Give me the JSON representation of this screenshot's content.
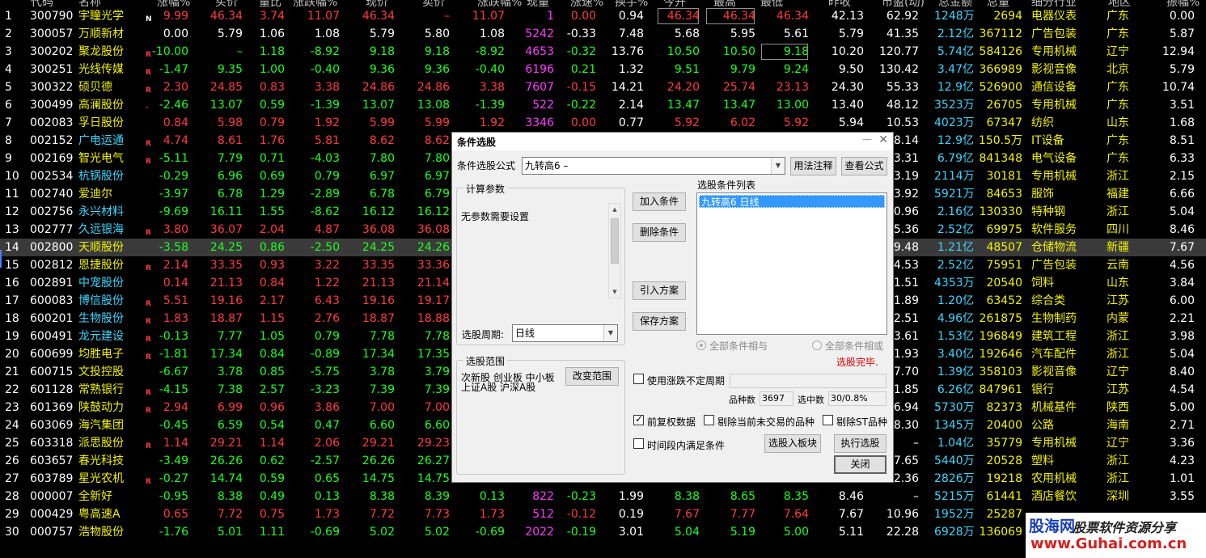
{
  "header": [
    "代码",
    "名称",
    "涨幅%",
    "买价",
    "量比",
    "涨跌幅%",
    "现价",
    "卖价",
    "涨跌幅%",
    "现量",
    "涨速%",
    "换手%",
    "今开",
    "最高",
    "最低",
    "昨收",
    "市盈(动)",
    "总金额",
    "总量",
    "细分行业",
    "地区",
    "振幅%"
  ],
  "rows": [
    {
      "n": "1",
      "code": "300790",
      "name": "宇瞳光学",
      "tag": "N",
      "chg": "9.99",
      "buy": "46.34",
      "vr": "3.74",
      "pct": "11.07",
      "price": "46.34",
      "sell": "–",
      "pct2": "11.07",
      "vol": "1",
      "spd": "0.00",
      "turn": "0.94",
      "open": "46.34",
      "high": "46.34",
      "low": "46.34",
      "prev": "42.13",
      "pe": "62.92",
      "amt": "1248万",
      "qty": "2694",
      "ind": "电器仪表",
      "area": "广东",
      "amp": "0.00",
      "nc": "yellow",
      "dc": "red"
    },
    {
      "n": "2",
      "code": "300057",
      "name": "万顺新材",
      "tag": "",
      "chg": "0.00",
      "buy": "5.79",
      "vr": "1.06",
      "pct": "1.08",
      "price": "5.79",
      "sell": "5.80",
      "pct2": "1.08",
      "vol": "5242",
      "spd": "-0.33",
      "turn": "7.48",
      "open": "5.68",
      "high": "5.95",
      "low": "5.61",
      "prev": "5.79",
      "pe": "41.35",
      "amt": "2.12亿",
      "qty": "367112",
      "ind": "广告包装",
      "area": "广东",
      "amp": "5.87",
      "nc": "yellow",
      "dc": "white"
    },
    {
      "n": "3",
      "code": "300202",
      "name": "聚龙股份",
      "tag": "R",
      "chg": "-10.00",
      "buy": "–",
      "vr": "1.18",
      "pct": "-8.92",
      "price": "9.18",
      "sell": "9.18",
      "pct2": "-8.92",
      "vol": "4653",
      "spd": "-0.32",
      "turn": "13.76",
      "open": "10.50",
      "high": "10.50",
      "low": "9.18",
      "prev": "10.20",
      "pe": "120.77",
      "amt": "5.74亿",
      "qty": "584126",
      "ind": "专用机械",
      "area": "辽宁",
      "amp": "12.94",
      "nc": "yellow",
      "dc": "green"
    },
    {
      "n": "4",
      "code": "300251",
      "name": "光线传媒",
      "tag": "R",
      "chg": "-1.47",
      "buy": "9.35",
      "vr": "1.00",
      "pct": "-0.40",
      "price": "9.36",
      "sell": "9.36",
      "pct2": "-0.40",
      "vol": "6196",
      "spd": "0.21",
      "turn": "1.32",
      "open": "9.51",
      "high": "9.79",
      "low": "9.24",
      "prev": "9.50",
      "pe": "130.42",
      "amt": "3.47亿",
      "qty": "366989",
      "ind": "影视音像",
      "area": "北京",
      "amp": "5.79",
      "nc": "yellow",
      "dc": "green"
    },
    {
      "n": "5",
      "code": "300322",
      "name": "硕贝德",
      "tag": "R",
      "chg": "2.30",
      "buy": "24.85",
      "vr": "0.83",
      "pct": "3.38",
      "price": "24.86",
      "sell": "24.86",
      "pct2": "3.38",
      "vol": "7607",
      "spd": "-0.15",
      "turn": "14.21",
      "open": "24.20",
      "high": "25.74",
      "low": "23.13",
      "prev": "24.30",
      "pe": "55.33",
      "amt": "12.9亿",
      "qty": "526900",
      "ind": "通信设备",
      "area": "广东",
      "amp": "10.74",
      "nc": "yellow",
      "dc": "red"
    },
    {
      "n": "6",
      "code": "300499",
      "name": "高澜股份",
      "tag": "·",
      "chg": "-2.46",
      "buy": "13.07",
      "vr": "0.59",
      "pct": "-1.39",
      "price": "13.07",
      "sell": "13.08",
      "pct2": "-1.39",
      "vol": "522",
      "spd": "-0.22",
      "turn": "2.14",
      "open": "13.47",
      "high": "13.47",
      "low": "13.00",
      "prev": "13.40",
      "pe": "48.12",
      "amt": "3523万",
      "qty": "26705",
      "ind": "专用机械",
      "area": "广东",
      "amp": "3.51",
      "nc": "yellow",
      "dc": "green"
    },
    {
      "n": "7",
      "code": "002083",
      "name": "孚日股份",
      "tag": "",
      "chg": "0.84",
      "buy": "5.98",
      "vr": "0.79",
      "pct": "1.92",
      "price": "5.99",
      "sell": "5.99",
      "pct2": "1.92",
      "vol": "3346",
      "spd": "0.00",
      "turn": "0.77",
      "open": "5.92",
      "high": "6.02",
      "low": "5.92",
      "prev": "5.94",
      "pe": "10.53",
      "amt": "4023万",
      "qty": "67347",
      "ind": "纺织",
      "area": "山东",
      "amp": "1.68",
      "nc": "yellow",
      "dc": "red"
    },
    {
      "n": "8",
      "code": "002152",
      "name": "广电运通",
      "tag": "R",
      "chg": "4.74",
      "buy": "8.61",
      "vr": "1.76",
      "pct": "5.81",
      "price": "8.62",
      "sell": "8.62",
      "pct2": "",
      "vol": "",
      "spd": "",
      "turn": "",
      "open": "",
      "high": "",
      "low": "",
      "prev": "",
      "pe": "28.14",
      "amt": "12.9亿",
      "qty": "150.5万",
      "ind": "IT设备",
      "area": "广东",
      "amp": "8.51",
      "nc": "cyan",
      "dc": "red"
    },
    {
      "n": "9",
      "code": "002169",
      "name": "智光电气",
      "tag": "R",
      "chg": "-5.11",
      "buy": "7.79",
      "vr": "0.71",
      "pct": "-4.03",
      "price": "7.80",
      "sell": "7.80",
      "pct2": "",
      "vol": "",
      "spd": "",
      "turn": "",
      "open": "",
      "high": "",
      "low": "",
      "prev": "",
      "pe": "73.31",
      "amt": "6.79亿",
      "qty": "841348",
      "ind": "电气设备",
      "area": "广东",
      "amp": "6.33",
      "nc": "yellow",
      "dc": "green"
    },
    {
      "n": "10",
      "code": "002534",
      "name": "杭锅股份",
      "tag": "",
      "chg": "-0.29",
      "buy": "6.96",
      "vr": "0.69",
      "pct": "0.79",
      "price": "6.97",
      "sell": "6.97",
      "pct2": "",
      "vol": "",
      "spd": "",
      "turn": "",
      "open": "",
      "high": "",
      "low": "",
      "prev": "",
      "pe": "23.19",
      "amt": "2114万",
      "qty": "30181",
      "ind": "专用机械",
      "area": "浙江",
      "amp": "2.15",
      "nc": "cyan",
      "dc": "green"
    },
    {
      "n": "11",
      "code": "002740",
      "name": "爱迪尔",
      "tag": "",
      "chg": "-3.97",
      "buy": "6.78",
      "vr": "1.29",
      "pct": "-2.89",
      "price": "6.78",
      "sell": "6.79",
      "pct2": "",
      "vol": "",
      "spd": "",
      "turn": "",
      "open": "",
      "high": "",
      "low": "",
      "prev": "",
      "pe": "53.92",
      "amt": "5921万",
      "qty": "84653",
      "ind": "服饰",
      "area": "福建",
      "amp": "6.66",
      "nc": "yellow",
      "dc": "green"
    },
    {
      "n": "12",
      "code": "002756",
      "name": "永兴材料",
      "tag": "",
      "chg": "-9.69",
      "buy": "16.11",
      "vr": "1.55",
      "pct": "-8.62",
      "price": "16.12",
      "sell": "16.12",
      "pct2": "",
      "vol": "",
      "spd": "",
      "turn": "",
      "open": "",
      "high": "",
      "low": "",
      "prev": "",
      "pe": "10.96",
      "amt": "2.16亿",
      "qty": "130330",
      "ind": "特种钢",
      "area": "浙江",
      "amp": "5.04",
      "nc": "cyan",
      "dc": "green"
    },
    {
      "n": "13",
      "code": "002777",
      "name": "久远银海",
      "tag": "R",
      "chg": "3.80",
      "buy": "36.07",
      "vr": "2.04",
      "pct": "4.87",
      "price": "36.08",
      "sell": "36.08",
      "pct2": "",
      "vol": "",
      "spd": "",
      "turn": "",
      "open": "",
      "high": "",
      "low": "",
      "prev": "",
      "pe": "55.36",
      "amt": "2.52亿",
      "qty": "69975",
      "ind": "软件服务",
      "area": "四川",
      "amp": "8.46",
      "nc": "cyan",
      "dc": "red"
    },
    {
      "n": "14",
      "code": "002800",
      "name": "天顺股份",
      "tag": "",
      "chg": "-3.58",
      "buy": "24.25",
      "vr": "0.86",
      "pct": "-2.50",
      "price": "24.25",
      "sell": "24.26",
      "pct2": "",
      "vol": "",
      "spd": "",
      "turn": "",
      "open": "",
      "high": "",
      "low": "",
      "prev": "",
      "pe": "49.48",
      "amt": "1.21亿",
      "qty": "48507",
      "ind": "仓储物流",
      "area": "新疆",
      "amp": "7.67",
      "nc": "yellow",
      "dc": "green"
    },
    {
      "n": "15",
      "code": "002812",
      "name": "恩捷股份",
      "tag": "R",
      "chg": "2.14",
      "buy": "33.35",
      "vr": "0.93",
      "pct": "3.22",
      "price": "33.35",
      "sell": "33.36",
      "pct2": "",
      "vol": "",
      "spd": "",
      "turn": "",
      "open": "",
      "high": "",
      "low": "",
      "prev": "",
      "pe": "34.53",
      "amt": "2.52亿",
      "qty": "75951",
      "ind": "广告包装",
      "area": "云南",
      "amp": "4.56",
      "nc": "yellow",
      "dc": "red"
    },
    {
      "n": "16",
      "code": "002891",
      "name": "中宠股份",
      "tag": "",
      "chg": "0.14",
      "buy": "21.13",
      "vr": "0.84",
      "pct": "1.22",
      "price": "21.13",
      "sell": "21.14",
      "pct2": "",
      "vol": "",
      "spd": "",
      "turn": "",
      "open": "",
      "high": "",
      "low": "",
      "prev": "",
      "pe": "51.51",
      "amt": "4353万",
      "qty": "20540",
      "ind": "饲料",
      "area": "山东",
      "amp": "3.84",
      "nc": "cyan",
      "dc": "red"
    },
    {
      "n": "17",
      "code": "600083",
      "name": "博信股份",
      "tag": "R",
      "chg": "5.51",
      "buy": "19.16",
      "vr": "2.17",
      "pct": "6.43",
      "price": "19.16",
      "sell": "19.17",
      "pct2": "",
      "vol": "",
      "spd": "",
      "turn": "",
      "open": "",
      "high": "",
      "low": "",
      "prev": "",
      "pe": "–1.89",
      "amt": "1.20亿",
      "qty": "63452",
      "ind": "综合类",
      "area": "江苏",
      "amp": "6.00",
      "nc": "cyan",
      "dc": "red"
    },
    {
      "n": "18",
      "code": "600201",
      "name": "生物股份",
      "tag": "R",
      "chg": "1.83",
      "buy": "18.87",
      "vr": "1.15",
      "pct": "2.76",
      "price": "18.87",
      "sell": "18.88",
      "pct2": "",
      "vol": "",
      "spd": "",
      "turn": "",
      "open": "",
      "high": "",
      "low": "",
      "prev": "",
      "pe": "62.51",
      "amt": "4.96亿",
      "qty": "261875",
      "ind": "生物制药",
      "area": "内蒙",
      "amp": "2.21",
      "nc": "cyan",
      "dc": "red"
    },
    {
      "n": "19",
      "code": "600491",
      "name": "龙元建设",
      "tag": "R",
      "chg": "-0.13",
      "buy": "7.77",
      "vr": "1.05",
      "pct": "0.79",
      "price": "7.78",
      "sell": "7.78",
      "pct2": "",
      "vol": "",
      "spd": "",
      "turn": "",
      "open": "",
      "high": "",
      "low": "",
      "prev": "",
      "pe": "13.61",
      "amt": "1.53亿",
      "qty": "196849",
      "ind": "建筑工程",
      "area": "浙江",
      "amp": "3.98",
      "nc": "cyan",
      "dc": "green"
    },
    {
      "n": "20",
      "code": "600699",
      "name": "均胜电子",
      "tag": "R",
      "chg": "-1.81",
      "buy": "17.34",
      "vr": "0.84",
      "pct": "-0.89",
      "price": "17.34",
      "sell": "17.35",
      "pct2": "",
      "vol": "",
      "spd": "",
      "turn": "",
      "open": "",
      "high": "",
      "low": "",
      "prev": "",
      "pe": "21.93",
      "amt": "3.40亿",
      "qty": "192646",
      "ind": "汽车配件",
      "area": "浙江",
      "amp": "5.04",
      "nc": "yellow",
      "dc": "green"
    },
    {
      "n": "21",
      "code": "600715",
      "name": "文投控股",
      "tag": "",
      "chg": "-6.67",
      "buy": "3.78",
      "vr": "0.85",
      "pct": "-5.75",
      "price": "3.78",
      "sell": "3.79",
      "pct2": "",
      "vol": "",
      "spd": "",
      "turn": "",
      "open": "",
      "high": "",
      "low": "",
      "prev": "",
      "pe": "17.70",
      "amt": "1.39亿",
      "qty": "358103",
      "ind": "影视音像",
      "area": "辽宁",
      "amp": "8.40",
      "nc": "yellow",
      "dc": "green"
    },
    {
      "n": "22",
      "code": "601128",
      "name": "常熟银行",
      "tag": "R",
      "chg": "-4.15",
      "buy": "7.38",
      "vr": "2.57",
      "pct": "-3.23",
      "price": "7.39",
      "sell": "7.39",
      "pct2": "",
      "vol": "",
      "spd": "",
      "turn": "",
      "open": "",
      "high": "",
      "low": "",
      "prev": "",
      "pe": "11.85",
      "amt": "6.26亿",
      "qty": "847961",
      "ind": "银行",
      "area": "江苏",
      "amp": "4.54",
      "nc": "yellow",
      "dc": "green"
    },
    {
      "n": "23",
      "code": "601369",
      "name": "陕鼓动力",
      "tag": "R",
      "chg": "2.94",
      "buy": "6.99",
      "vr": "0.96",
      "pct": "3.86",
      "price": "7.00",
      "sell": "7.00",
      "pct2": "",
      "vol": "",
      "spd": "",
      "turn": "",
      "open": "",
      "high": "",
      "low": "",
      "prev": "",
      "pe": "16.94",
      "amt": "5730万",
      "qty": "82373",
      "ind": "机械基件",
      "area": "陕西",
      "amp": "5.00",
      "nc": "yellow",
      "dc": "red"
    },
    {
      "n": "24",
      "code": "603069",
      "name": "海汽集团",
      "tag": "",
      "chg": "-0.45",
      "buy": "6.59",
      "vr": "0.54",
      "pct": "0.47",
      "price": "6.60",
      "sell": "6.60",
      "pct2": "",
      "vol": "",
      "spd": "",
      "turn": "",
      "open": "",
      "high": "",
      "low": "",
      "prev": "",
      "pe": "38.30",
      "amt": "1345万",
      "qty": "20400",
      "ind": "公路",
      "area": "海南",
      "amp": "2.71",
      "nc": "yellow",
      "dc": "green"
    },
    {
      "n": "25",
      "code": "603318",
      "name": "派思股份",
      "tag": "R",
      "chg": "1.14",
      "buy": "29.21",
      "vr": "1.14",
      "pct": "2.06",
      "price": "29.21",
      "sell": "29.23",
      "pct2": "",
      "vol": "",
      "spd": "",
      "turn": "",
      "open": "",
      "high": "",
      "low": "",
      "prev": "",
      "pe": "–",
      "amt": "1.04亿",
      "qty": "35779",
      "ind": "专用机械",
      "area": "辽宁",
      "amp": "3.36",
      "nc": "yellow",
      "dc": "red"
    },
    {
      "n": "26",
      "code": "603657",
      "name": "春光科技",
      "tag": "",
      "chg": "-3.49",
      "buy": "26.26",
      "vr": "0.62",
      "pct": "-2.57",
      "price": "26.26",
      "sell": "26.27",
      "pct2": "",
      "vol": "",
      "spd": "",
      "turn": "",
      "open": "",
      "high": "",
      "low": "",
      "prev": "",
      "pe": "27.65",
      "amt": "5440万",
      "qty": "20528",
      "ind": "塑料",
      "area": "浙江",
      "amp": "4.23",
      "nc": "yellow",
      "dc": "green"
    },
    {
      "n": "27",
      "code": "603789",
      "name": "星光农机",
      "tag": "R",
      "chg": "-0.27",
      "buy": "14.74",
      "vr": "0.59",
      "pct": "0.65",
      "price": "14.75",
      "sell": "14.75",
      "pct2": "",
      "vol": "",
      "spd": "",
      "turn": "",
      "open": "",
      "high": "",
      "low": "",
      "prev": "",
      "pe": "72.36",
      "amt": "2826万",
      "qty": "19218",
      "ind": "农用机械",
      "area": "浙江",
      "amp": "1.01",
      "nc": "yellow",
      "dc": "green"
    },
    {
      "n": "28",
      "code": "000007",
      "name": "全新好",
      "tag": "",
      "chg": "-0.95",
      "buy": "8.38",
      "vr": "0.49",
      "pct": "0.13",
      "price": "8.38",
      "sell": "8.39",
      "pct2": "0.13",
      "vol": "822",
      "spd": "-0.23",
      "turn": "1.99",
      "open": "8.38",
      "high": "8.65",
      "low": "8.35",
      "prev": "8.46",
      "pe": "–",
      "amt": "5215万",
      "qty": "61441",
      "ind": "酒店餐饮",
      "area": "深圳",
      "amp": "3.55",
      "nc": "yellow",
      "dc": "green"
    },
    {
      "n": "29",
      "code": "000429",
      "name": "粤高速A",
      "tag": "",
      "chg": "0.65",
      "buy": "7.72",
      "vr": "0.75",
      "pct": "1.73",
      "price": "7.72",
      "sell": "7.73",
      "pct2": "1.73",
      "vol": "512",
      "spd": "-0.12",
      "turn": "0.19",
      "open": "7.67",
      "high": "7.77",
      "low": "7.64",
      "prev": "7.67",
      "pe": "10.96",
      "amt": "1952万",
      "qty": "25287",
      "ind": "",
      "area": "",
      "amp": "",
      "nc": "yellow",
      "dc": "red"
    },
    {
      "n": "30",
      "code": "000757",
      "name": "浩物股份",
      "tag": "",
      "chg": "-1.76",
      "buy": "5.01",
      "vr": "1.11",
      "pct": "-0.69",
      "price": "5.02",
      "sell": "5.02",
      "pct2": "-0.69",
      "vol": "2022",
      "spd": "-0.19",
      "turn": "3.01",
      "open": "5.04",
      "high": "5.19",
      "low": "5.00",
      "prev": "5.11",
      "pe": "22.28",
      "amt": "6928万",
      "qty": "136069",
      "ind": "",
      "area": "",
      "amp": "",
      "nc": "yellow",
      "dc": "green"
    }
  ],
  "dialog": {
    "title": "条件选股",
    "formula_label": "条件选股公式",
    "formula_value": "九转高6        –",
    "btn_usage": "用法注释",
    "btn_view": "查看公式",
    "calc_params_title": "计算参数",
    "no_params_text": "无参数需要设置",
    "period_label": "选股周期:",
    "period_value": "日线",
    "btn_add": "加入条件",
    "btn_delete": "删除条件",
    "btn_import": "引入方案",
    "btn_save": "保存方案",
    "cond_list_title": "选股条件列表",
    "cond_item": "九转高6   日线",
    "radio_and": "全部条件相与",
    "radio_or": "全部条件相或",
    "status": "选股完毕.",
    "range_title": "选股范围",
    "range_text_1": "次新股 创业板 中小板",
    "range_text_2": "上证A股 沪深A股",
    "btn_change_range": "改变范围",
    "chk_period": "使用涨跌不定周期",
    "count_label": "品种数",
    "count_value": "3697",
    "selected_label": "选中数",
    "selected_value": "30/0.8%",
    "chk_adjust": "前复权数据",
    "chk_exclude_untraded": "剔除当前未交易的品种",
    "chk_exclude_st": "剔除ST品种",
    "chk_time": "时间段内满足条件",
    "btn_to_block": "选股入板块",
    "btn_execute": "执行选股",
    "btn_close": "关闭"
  },
  "watermark": {
    "site": "股海网",
    "slogan": "股票软件资源分享",
    "url": "www.Guhai.com.cn"
  }
}
